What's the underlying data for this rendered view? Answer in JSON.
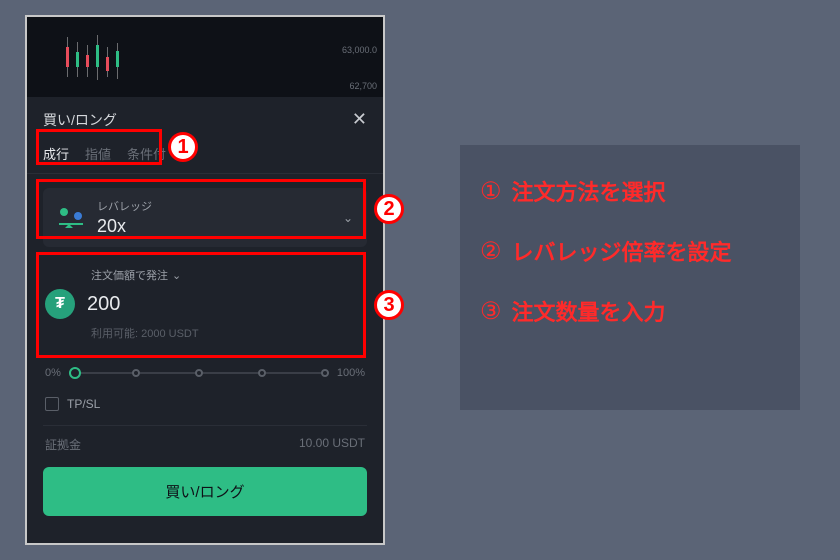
{
  "sheet": {
    "title": "買い/ロング",
    "tabs": [
      "成行",
      "指値",
      "条件付"
    ],
    "active_tab_index": 0
  },
  "chart": {
    "price_upper": "63,000.0",
    "price_lower": "62,700"
  },
  "leverage": {
    "label": "レバレッジ",
    "value": "20x"
  },
  "amount": {
    "mode_label": "注文価額で発注",
    "value": "200",
    "available_label": "利用可能: 2000 USDT",
    "token_symbol": "₮"
  },
  "slider": {
    "left": "0%",
    "right": "100%"
  },
  "tpsl": {
    "label": "TP/SL",
    "checked": false
  },
  "margin": {
    "label": "証拠金",
    "value": "10.00 USDT"
  },
  "submit": {
    "label": "買い/ロング"
  },
  "legend": {
    "items": [
      {
        "num": "①",
        "text": "注文方法を選択"
      },
      {
        "num": "②",
        "text": "レバレッジ倍率を設定"
      },
      {
        "num": "③",
        "text": "注文数量を入力"
      }
    ]
  },
  "callouts": {
    "n1": "1",
    "n2": "2",
    "n3": "3"
  }
}
